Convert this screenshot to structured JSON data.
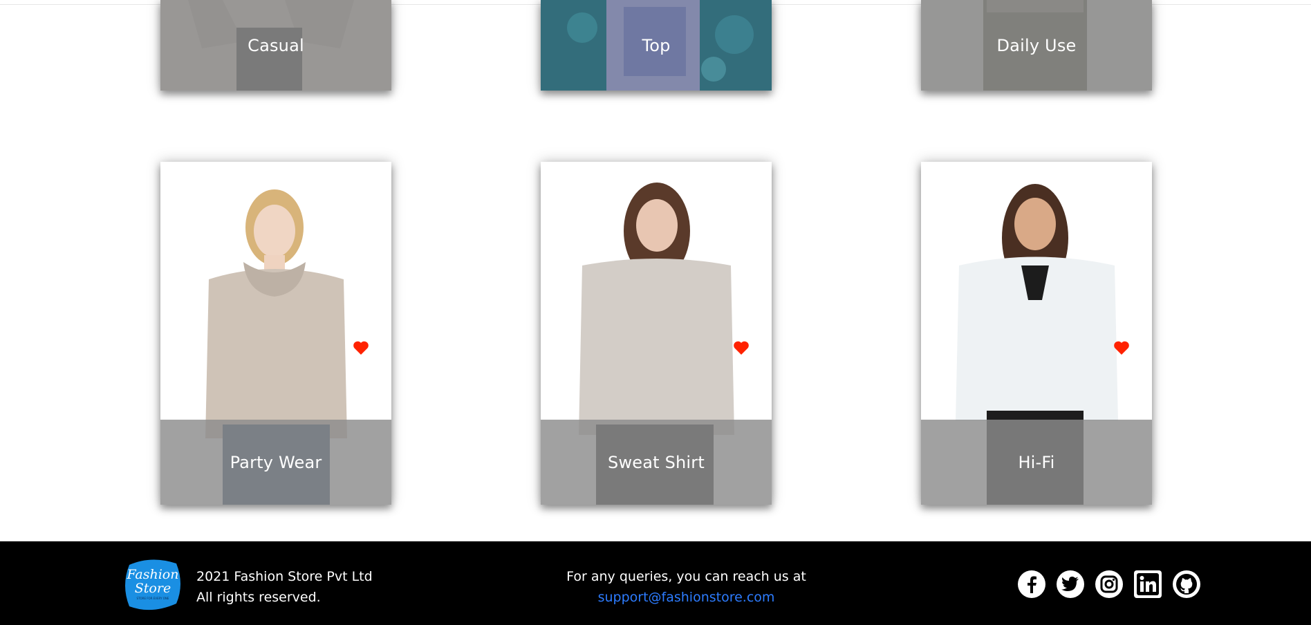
{
  "categories": [
    {
      "label": "Casual"
    },
    {
      "label": "Top"
    },
    {
      "label": "Daily Use"
    },
    {
      "label": "Party Wear"
    },
    {
      "label": "Sweat Shirt"
    },
    {
      "label": "Hi-Fi"
    }
  ],
  "footer": {
    "logo_text_line1": "Fashion",
    "logo_text_line2": "Store",
    "logo_tagline": "STORE FOR EVERY ONE",
    "copyright": "2021 Fashion Store Pvt Ltd",
    "rights": "All rights reserved.",
    "contact_text": "For any queries, you can reach us at",
    "email": "support@fashionstore.com",
    "social": [
      "facebook-icon",
      "twitter-icon",
      "instagram-icon",
      "linkedin-icon",
      "github-icon"
    ]
  },
  "colors": {
    "heart": "#ff2200",
    "band": "#8c8c8c",
    "link": "#2d7cff",
    "logo": "#1a8fe3"
  }
}
